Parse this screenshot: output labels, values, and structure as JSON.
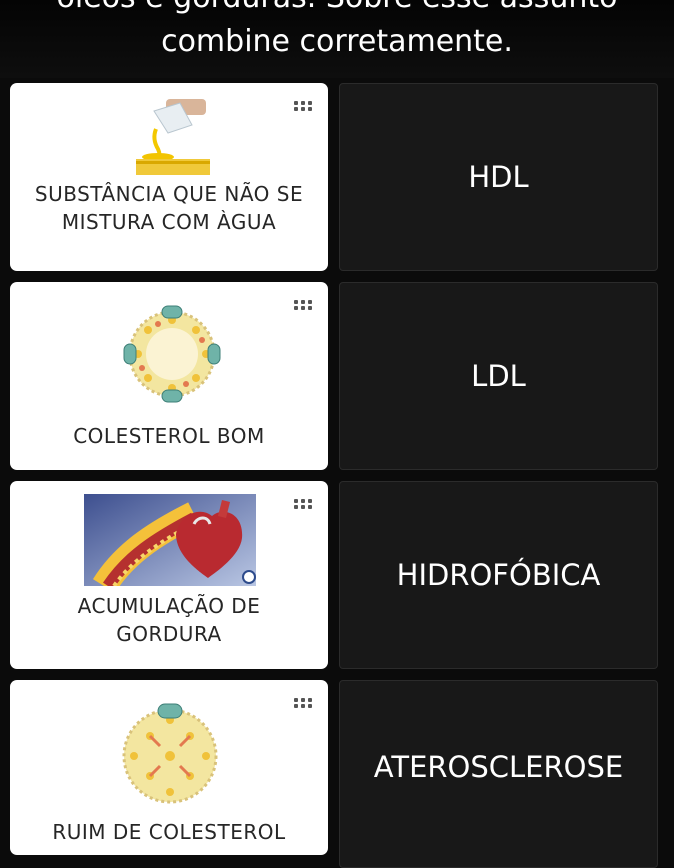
{
  "header": {
    "line1": "óleos e gorduras. Sobre esse assunto",
    "line2": "combine corretamente."
  },
  "cards": [
    {
      "label": "SUBSTÂNCIA QUE NÃO SE MISTURA COM ÀGUA",
      "image": "oil-pouring-image"
    },
    {
      "label": "COLESTEROL BOM",
      "image": "lipoprotein-hdl-image"
    },
    {
      "label": "ACUMULAÇÃO DE GORDURA",
      "image": "clogged-artery-heart-image"
    },
    {
      "label": "RUIM DE COLESTEROL",
      "image": "lipoprotein-ldl-image"
    }
  ],
  "answers": [
    {
      "label": "HDL"
    },
    {
      "label": "LDL"
    },
    {
      "label": "HIDROFÓBICA"
    },
    {
      "label": "ATEROSCLEROSE"
    }
  ],
  "icons": {
    "drag_handle": "drag-handle-icon",
    "zoom": "zoom-icon"
  },
  "colors": {
    "background": "#0b0b0b",
    "card": "#ffffff",
    "answer_box": "#181818",
    "text_dark": "#262626",
    "text_light": "#ffffff"
  }
}
